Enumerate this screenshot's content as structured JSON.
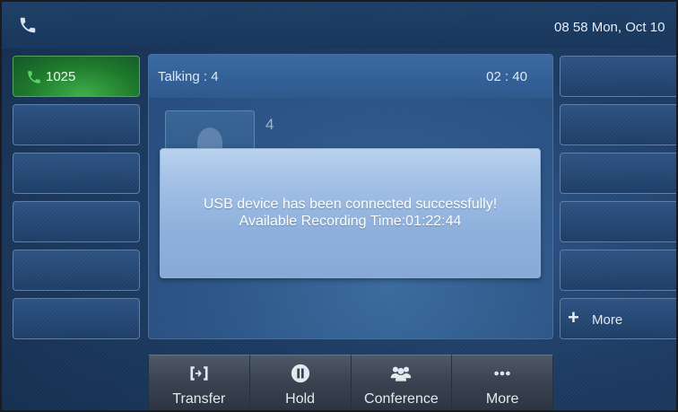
{
  "status_bar": {
    "phone_icon": "handset-icon",
    "datetime": "08 58 Mon, Oct 10"
  },
  "line_keys_left": [
    {
      "label": "1025",
      "icon": "handset-icon",
      "state": "active",
      "color": "#2a8a36"
    },
    {
      "label": ""
    },
    {
      "label": ""
    },
    {
      "label": ""
    },
    {
      "label": ""
    },
    {
      "label": ""
    }
  ],
  "line_keys_right": [
    {
      "label": ""
    },
    {
      "label": ""
    },
    {
      "label": ""
    },
    {
      "label": ""
    },
    {
      "label": ""
    },
    {
      "label": "More",
      "icon": "plus-icon"
    }
  ],
  "call": {
    "status": "Talking : 4",
    "timer": "02 : 40",
    "contact_name": "4",
    "avatar_icon": "person-silhouette-icon"
  },
  "popup": {
    "line1": "USB device has been connected successfully!",
    "line2": "Available Recording Time:01:22:44"
  },
  "softkeys": [
    {
      "label": "Transfer",
      "icon": "transfer-icon"
    },
    {
      "label": "Hold",
      "icon": "pause-icon"
    },
    {
      "label": "Conference",
      "icon": "conference-icon"
    },
    {
      "label": "More",
      "icon": "more-dots-icon"
    }
  ],
  "colors": {
    "background": "#1c3b63",
    "active_line": "#2a8a36",
    "popup": "#9dbbe3",
    "softkey": "#3a4352"
  }
}
